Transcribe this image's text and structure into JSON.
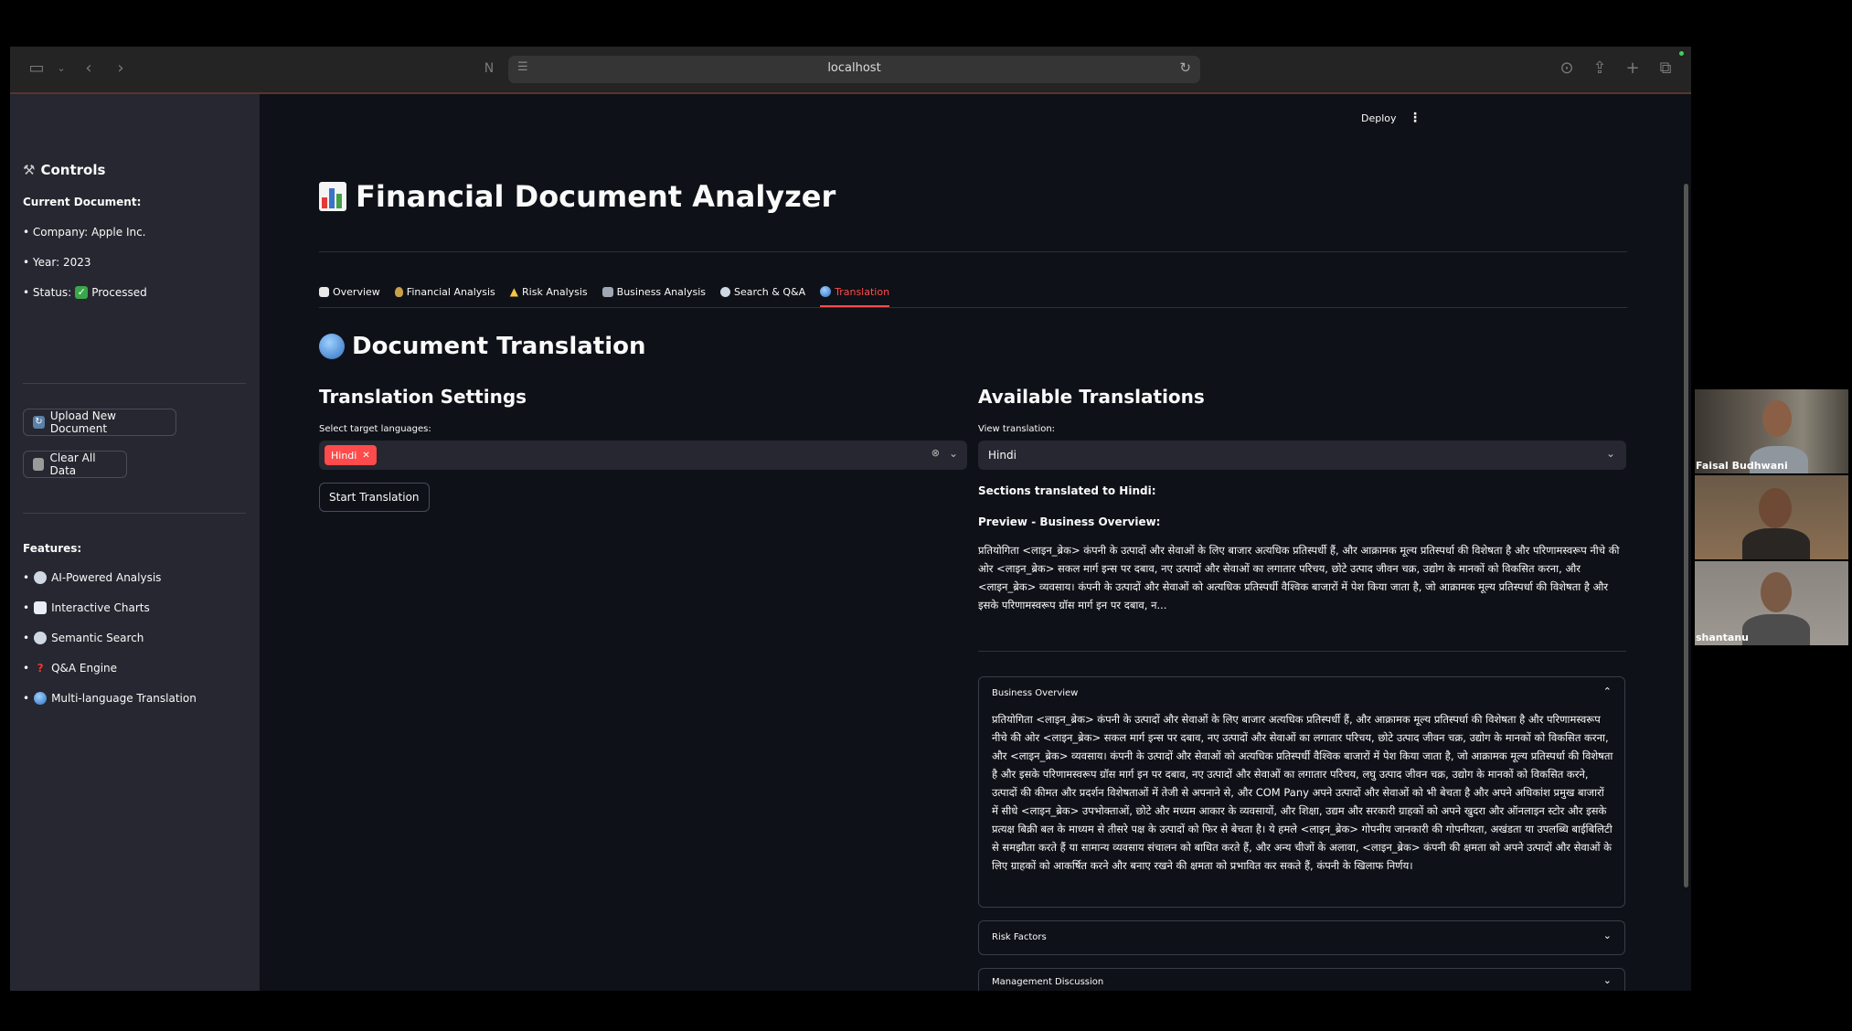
{
  "browser": {
    "url": "localhost"
  },
  "header": {
    "deploy_label": "Deploy",
    "menu_glyph": "⋮"
  },
  "sidebar": {
    "controls_title": "Controls",
    "current_document_label": "Current Document:",
    "company_line": "• Company: Apple Inc.",
    "year_line": "• Year: 2023",
    "status_prefix": "• Status:",
    "status_value": "Processed",
    "upload_button": "Upload New Document",
    "clear_button": "Clear All Data",
    "features_label": "Features:",
    "features": [
      "AI-Powered Analysis",
      "Interactive Charts",
      "Semantic Search",
      "Q&A Engine",
      "Multi-language Translation"
    ]
  },
  "main": {
    "app_title": "Financial Document Analyzer",
    "tabs": [
      {
        "label": "Overview",
        "active": false
      },
      {
        "label": "Financial Analysis",
        "active": false
      },
      {
        "label": "Risk Analysis",
        "active": false
      },
      {
        "label": "Business Analysis",
        "active": false
      },
      {
        "label": "Search & Q&A",
        "active": false
      },
      {
        "label": "Translation",
        "active": true
      }
    ],
    "section_title": "Document Translation",
    "settings": {
      "title": "Translation Settings",
      "select_label": "Select target languages:",
      "selected_chip": "Hindi",
      "start_button": "Start Translation"
    },
    "available": {
      "title": "Available Translations",
      "view_label": "View translation:",
      "view_value": "Hindi",
      "sections_line": "Sections translated to Hindi:",
      "preview_title": "Preview - Business Overview:",
      "preview_text": "प्रतियोगिता <लाइन_ब्रेक> कंपनी के उत्पादों और सेवाओं के लिए बाजार अत्यधिक प्रतिस्पर्धी हैं, और आक्रामक मूल्य प्रतिस्पर्धा की विशेषता है और परिणामस्वरूप नीचे की ओर <लाइन_ब्रेक> सकल मार्ग इन्स पर दबाव, नए उत्पादों और सेवाओं का लगातार परिचय, छोटे उत्पाद जीवन चक्र, उद्योग के मानकों को विकसित करना, और <लाइन_ब्रेक> व्यवसाय। कंपनी के उत्पादों और सेवाओं को अत्यधिक प्रतिस्पर्धी वैश्विक बाजारों में पेश किया जाता है, जो आक्रामक मूल्य प्रतिस्पर्धा की विशेषता है और इसके परिणामस्वरूप ग्रॉस मार्ग इन पर दबाव, न...",
      "expanders": [
        {
          "title": "Business Overview",
          "open": true,
          "body": "प्रतियोगिता <लाइन_ब्रेक> कंपनी के उत्पादों और सेवाओं के लिए बाजार अत्यधिक प्रतिस्पर्धी हैं, और आक्रामक मूल्य प्रतिस्पर्धा की विशेषता है और परिणामस्वरूप नीचे की ओर <लाइन_ब्रेक> सकल मार्ग इन्स पर दबाव, नए उत्पादों और सेवाओं का लगातार परिचय, छोटे उत्पाद जीवन चक्र, उद्योग के मानकों को विकसित करना, और <लाइन_ब्रेक> व्यवसाय। कंपनी के उत्पादों और सेवाओं को अत्यधिक प्रतिस्पर्धी वैश्विक बाजारों में पेश किया जाता है, जो आक्रामक मूल्य प्रतिस्पर्धा की विशेषता है और इसके परिणामस्वरूप ग्रॉस मार्ग इन पर दबाव, नए उत्पादों और सेवाओं का लगातार परिचय, लघु उत्पाद जीवन चक्र, उद्योग के मानकों को विकसित करने, उत्पादों की कीमत और प्रदर्शन विशेषताओं में तेजी से अपनाने से, और COM Pany अपने उत्पादों और सेवाओं को भी बेचता है और अपने अधिकांश प्रमुख बाजारों में सीधे <लाइन_ब्रेक> उपभोक्ताओं, छोटे और मध्यम आकार के व्यवसायों, और शिक्षा, उद्यम और सरकारी ग्राहकों को अपने खुदरा और ऑनलाइन स्टोर और इसके प्रत्यक्ष बिक्री बल के माध्यम से तीसरे पक्ष के उत्पादों को फिर से बेचता है। ये हमले <लाइन_ब्रेक> गोपनीय जानकारी की गोपनीयता, अखंडता या उपलब्धि बाईबिलिटी से समझौता करते हैं या सामान्य व्यवसाय संचालन को बाधित करते हैं, और अन्य चीजों के अलावा, <लाइन_ब्रेक> कंपनी की क्षमता को अपने उत्पादों और सेवाओं के लिए ग्राहकों को आकर्षित करने और बनाए रखने की क्षमता को प्रभावित कर सकते हैं, कंपनी के खिलाफ निर्णय।"
        },
        {
          "title": "Risk Factors",
          "open": false
        },
        {
          "title": "Management Discussion",
          "open": false
        }
      ]
    }
  },
  "participants": [
    {
      "name": "Faisal Budhwani"
    },
    {
      "name": ""
    },
    {
      "name": "shantanu"
    }
  ]
}
